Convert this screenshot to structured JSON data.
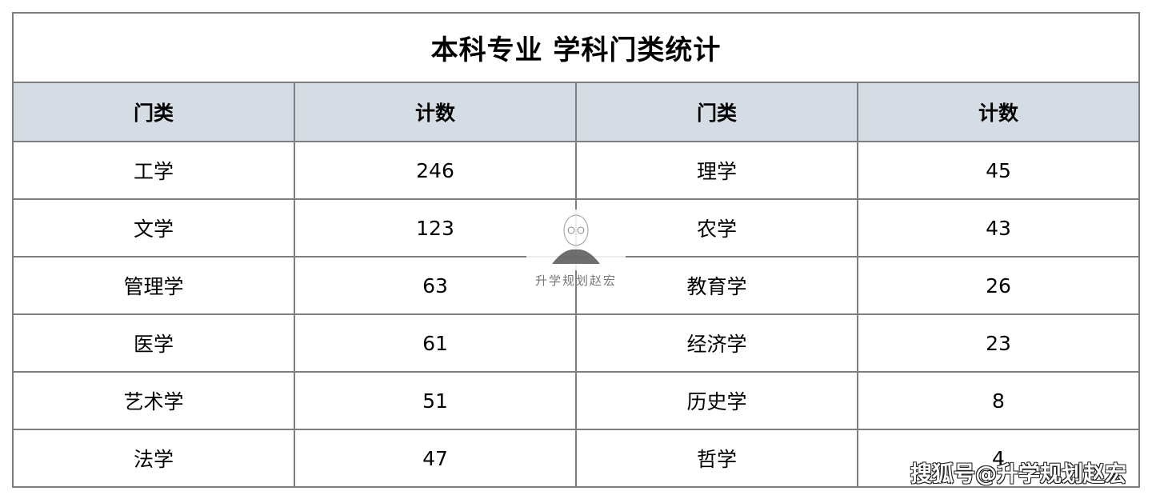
{
  "title": "本科专业 学科门类统计",
  "headers": [
    "门类",
    "计数",
    "门类",
    "计数"
  ],
  "rows": [
    [
      "工学",
      "246",
      "理学",
      "45"
    ],
    [
      "文学",
      "123",
      "农学",
      "43"
    ],
    [
      "管理学",
      "63",
      "教育学",
      "26"
    ],
    [
      "医学",
      "61",
      "经济学",
      "23"
    ],
    [
      "艺术学",
      "51",
      "历史学",
      "8"
    ],
    [
      "法学",
      "47",
      "哲学",
      "4"
    ]
  ],
  "watermark": {
    "center_text": "升学规划赵宏",
    "corner_text": "搜狐号@升学规划赵宏"
  }
}
